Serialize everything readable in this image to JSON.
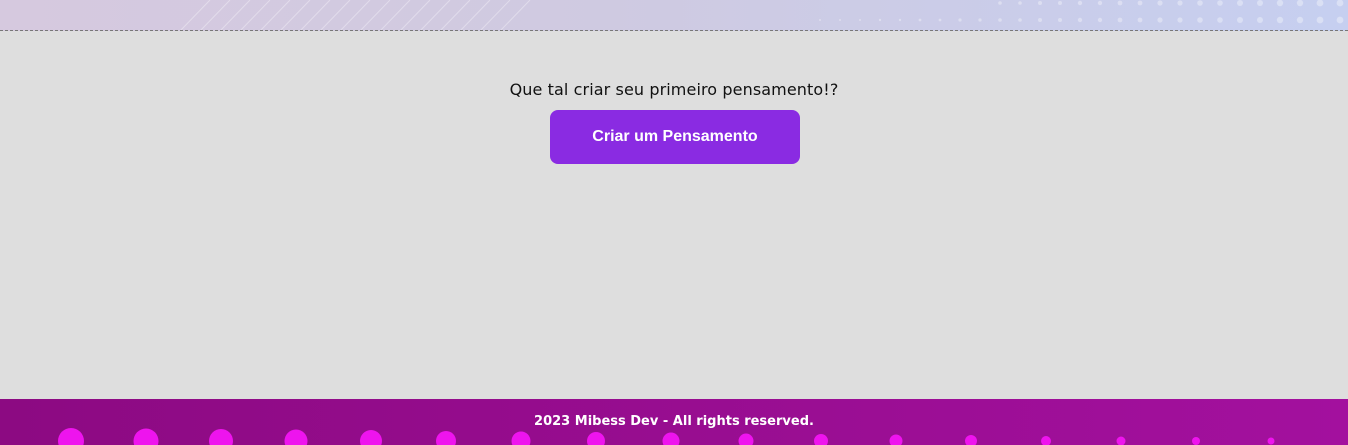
{
  "main": {
    "empty_message": "Que tal criar seu primeiro pensamento!?",
    "create_button_label": "Criar um Pensamento"
  },
  "footer": {
    "copyright": "2023 Mibess Dev - All rights reserved."
  },
  "colors": {
    "button": "#8a2be2",
    "footer": "#9b0e95",
    "footer_dots": "#ee14ee",
    "background": "#dedede"
  }
}
